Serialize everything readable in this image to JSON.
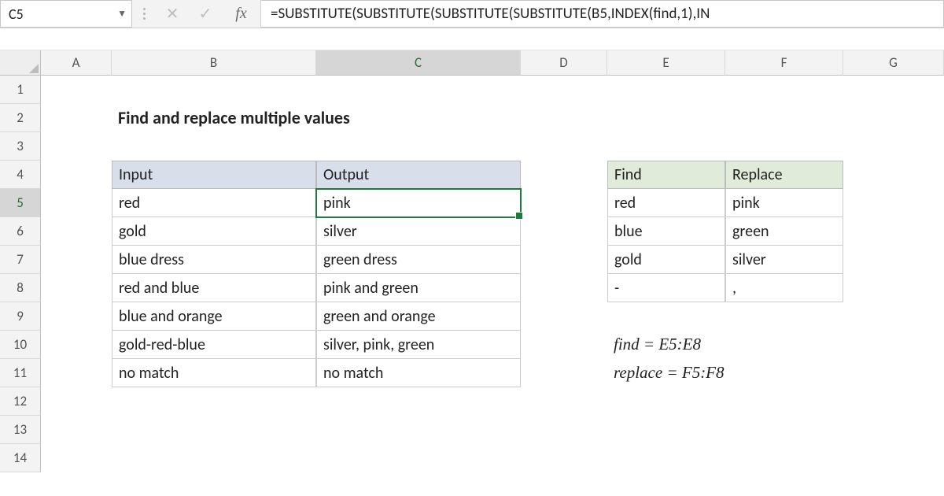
{
  "nameBox": "C5",
  "formula": "=SUBSTITUTE(SUBSTITUTE(SUBSTITUTE(SUBSTITUTE(B5,INDEX(find,1),IN",
  "fxLabel": "fx",
  "columns": [
    "A",
    "B",
    "C",
    "D",
    "E",
    "F",
    "G"
  ],
  "rows": [
    "1",
    "2",
    "3",
    "4",
    "5",
    "6",
    "7",
    "8",
    "9",
    "10",
    "11",
    "12",
    "13",
    "14"
  ],
  "activeCol": "C",
  "activeRow": "5",
  "title": "Find and replace multiple values",
  "table1": {
    "headers": [
      "Input",
      "Output"
    ],
    "rows": [
      [
        "red",
        "pink"
      ],
      [
        "gold",
        "silver"
      ],
      [
        "blue dress",
        "green dress"
      ],
      [
        "red and blue",
        "pink and green"
      ],
      [
        "blue and orange",
        "green and orange"
      ],
      [
        "gold-red-blue",
        "silver, pink, green"
      ],
      [
        "no match",
        "no match"
      ]
    ]
  },
  "table2": {
    "headers": [
      "Find",
      "Replace"
    ],
    "rows": [
      [
        "red",
        "pink"
      ],
      [
        "blue",
        "green"
      ],
      [
        "gold",
        "silver"
      ],
      [
        "-",
        ","
      ]
    ]
  },
  "notes": [
    "find = E5:E8",
    "replace = F5:F8"
  ]
}
